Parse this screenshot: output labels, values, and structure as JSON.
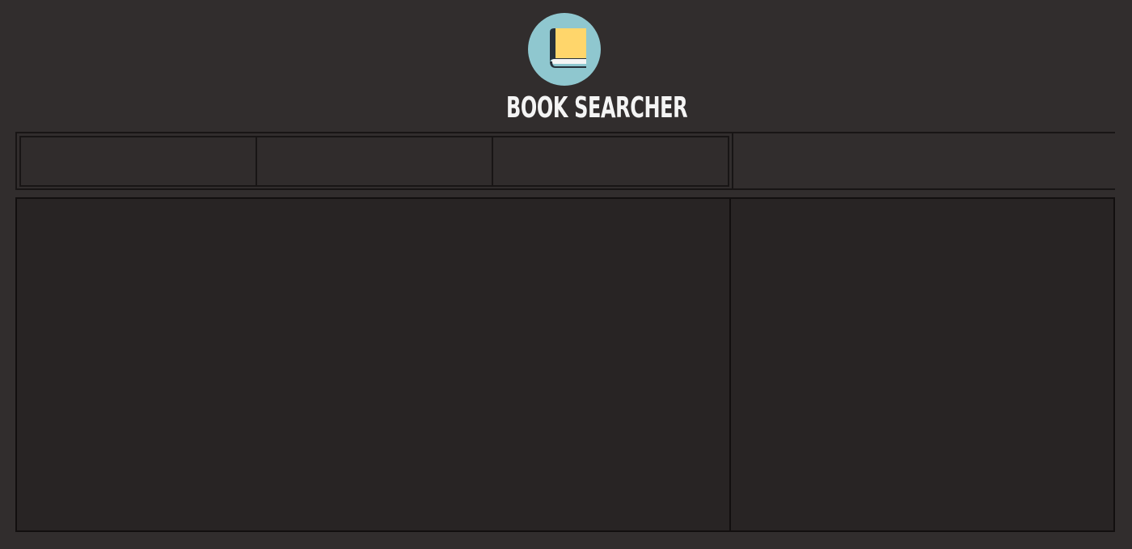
{
  "header": {
    "title": "BOOK SEARCHER",
    "logo_icon": "book-icon"
  },
  "colors": {
    "page_background": "#312d2d",
    "panel_background": "#282424",
    "border": "#181515",
    "logo_circle": "#8fc7cf",
    "book_cover": "#ffd66b",
    "book_spine": "#25303a",
    "title_text": "#f4f4f4"
  }
}
